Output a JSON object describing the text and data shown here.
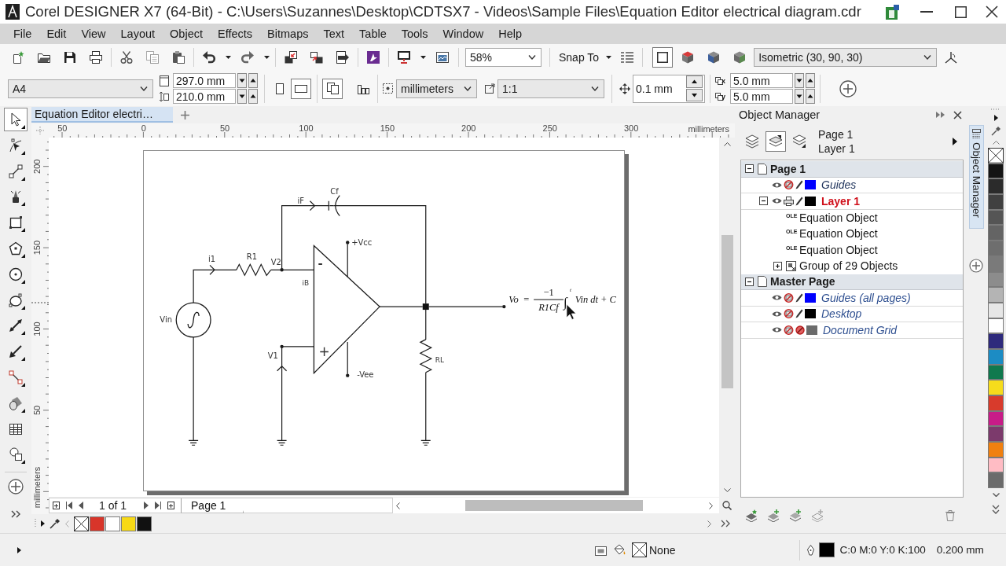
{
  "window": {
    "title": "Corel DESIGNER X7 (64-Bit) - C:\\Users\\Suzannes\\Desktop\\CDTSX7 - Videos\\Sample Files\\Equation Editor electrical diagram.cdr"
  },
  "menu": [
    "File",
    "Edit",
    "View",
    "Layout",
    "Object",
    "Effects",
    "Bitmaps",
    "Text",
    "Table",
    "Tools",
    "Window",
    "Help"
  ],
  "toolbar": {
    "zoom": "58%",
    "snap_to": "Snap To",
    "drawing_planes": [
      {
        "selected": true
      },
      {
        "selected": false
      },
      {
        "selected": false
      },
      {
        "selected": false
      }
    ],
    "projection": "Isometric (30, 90, 30)"
  },
  "property_bar": {
    "paper": "A4",
    "width": "297.0 mm",
    "height": "210.0 mm",
    "orientation": [
      {
        "selected": false
      },
      {
        "selected": true
      }
    ],
    "page_scope": [
      {
        "selected": true
      },
      {
        "selected": false
      }
    ],
    "units": "millimeters",
    "scale": "1:1",
    "nudge": "0.1 mm",
    "duplicate": [
      {
        "axis": "x",
        "value": "5.0 mm"
      },
      {
        "axis": "y",
        "value": "5.0 mm"
      }
    ]
  },
  "toolbox": [
    {
      "selected": true,
      "flyout": true
    },
    {
      "selected": false,
      "flyout": true
    },
    {
      "selected": false,
      "flyout": true
    },
    {
      "selected": false,
      "flyout": true
    },
    {
      "selected": false,
      "flyout": true
    },
    {
      "selected": false,
      "flyout": true
    },
    {
      "selected": false,
      "flyout": true
    },
    {
      "selected": false,
      "flyout": true
    },
    {
      "selected": false,
      "flyout": true
    },
    {
      "selected": false,
      "flyout": true
    },
    {
      "selected": false,
      "flyout": true
    },
    {
      "selected": false,
      "flyout": true
    },
    {
      "selected": false,
      "flyout": false
    },
    {
      "selected": false,
      "flyout": true
    }
  ],
  "document": {
    "tab": "Equation Editor electri…",
    "rulers": {
      "horizontal": [
        "50",
        "0",
        "50",
        "100",
        "150",
        "200",
        "250",
        "300"
      ],
      "horizontal_unit": "millimeters",
      "vertical": [
        "200",
        "150",
        "100",
        "50"
      ],
      "vertical_unit": "millimeters"
    },
    "circuit": {
      "source": "Vin",
      "input_current": "i1",
      "input_resistor": "R1",
      "inverting_node": "V2",
      "bias_current": "iB",
      "feedback_current": "iF",
      "feedback_capacitor": "Cf",
      "inverting_input": "-",
      "noninverting_input": "+",
      "positive_supply": "+Vcc",
      "negative_supply": "-Vee",
      "noninverting_node": "V1",
      "load_resistor": "RL",
      "equation": {
        "lhs": "Vo",
        "equals": "=",
        "numerator": "−1",
        "denominator": "R1Cf",
        "integral": "∫",
        "upper_limit": "t",
        "integrand": "Vin dt + C"
      }
    },
    "page_navigator": {
      "position": "1 of 1",
      "pages": [
        {
          "label": "Page 1",
          "selected": true
        }
      ]
    },
    "palette": [
      {
        "kind": "none"
      },
      {
        "kind": "color",
        "color": "#d8352a"
      },
      {
        "kind": "color",
        "color": "#ffffff"
      },
      {
        "kind": "color",
        "color": "#f7d916"
      },
      {
        "kind": "color",
        "color": "#111111"
      }
    ]
  },
  "object_manager": {
    "title": "Object Manager",
    "views": [
      {
        "selected": false
      },
      {
        "selected": true
      },
      {
        "selected": false
      }
    ],
    "current_page": "Page 1",
    "current_layer": "Layer 1",
    "pages": [
      {
        "label": "Page 1",
        "expanded": true,
        "layers": [
          {
            "label": "Guides",
            "kind": "special",
            "active": false,
            "visible": true,
            "printable": false,
            "editable": true,
            "color": "#0000ff"
          },
          {
            "label": "Layer 1",
            "kind": "layer",
            "active": true,
            "visible": true,
            "printable": true,
            "editable": true,
            "color": "#000000",
            "expanded": true,
            "children": [
              {
                "label": "Equation Object",
                "kind": "ole",
                "badge": "OLE"
              },
              {
                "label": "Equation Object",
                "kind": "ole",
                "badge": "OLE"
              },
              {
                "label": "Equation Object",
                "kind": "ole",
                "badge": "OLE"
              },
              {
                "label": "Group of 29 Objects",
                "kind": "group",
                "expanded": false
              }
            ]
          }
        ]
      },
      {
        "label": "Master Page",
        "expanded": true,
        "layers": [
          {
            "label": "Guides (all pages)",
            "kind": "master",
            "active": false,
            "visible": true,
            "printable": false,
            "editable": true,
            "color": "#0000ff"
          },
          {
            "label": "Desktop",
            "kind": "master",
            "active": false,
            "visible": true,
            "printable": false,
            "editable": true,
            "color": "#000000"
          },
          {
            "label": "Document Grid",
            "kind": "master",
            "active": false,
            "visible": true,
            "printable": false,
            "editable": false,
            "color": "#6b6b6b"
          }
        ]
      }
    ]
  },
  "docker_tab": "Object Manager",
  "color_palette": [
    {
      "kind": "none"
    },
    {
      "kind": "color",
      "color": "#141414"
    },
    {
      "kind": "color",
      "color": "#2b2b2b"
    },
    {
      "kind": "color",
      "color": "#404040"
    },
    {
      "kind": "color",
      "color": "#555555"
    },
    {
      "kind": "color",
      "color": "#646464"
    },
    {
      "kind": "color",
      "color": "#6e6e6e"
    },
    {
      "kind": "color",
      "color": "#7a7a7a"
    },
    {
      "kind": "color",
      "color": "#8c8c8c"
    },
    {
      "kind": "color",
      "color": "#b4b4b4"
    },
    {
      "kind": "color",
      "color": "#e6e6e6"
    },
    {
      "kind": "color",
      "color": "#ffffff"
    },
    {
      "kind": "color",
      "color": "#2e2a7c"
    },
    {
      "kind": "color",
      "color": "#1c8cc4"
    },
    {
      "kind": "color",
      "color": "#10794e"
    },
    {
      "kind": "color",
      "color": "#f6dc1c"
    },
    {
      "kind": "color",
      "color": "#d83b2c"
    },
    {
      "kind": "color",
      "color": "#c81c88"
    },
    {
      "kind": "color",
      "color": "#7c3a6c"
    },
    {
      "kind": "color",
      "color": "#f08010"
    },
    {
      "kind": "color",
      "color": "#ffbcc4"
    },
    {
      "kind": "color",
      "color": "#6b6b6b"
    }
  ],
  "status_bar": {
    "fill": {
      "kind": "none",
      "label": "None"
    },
    "outline": {
      "color": "#000000",
      "values": "C:0 M:0 Y:0 K:100",
      "width": "0.200 mm"
    }
  }
}
